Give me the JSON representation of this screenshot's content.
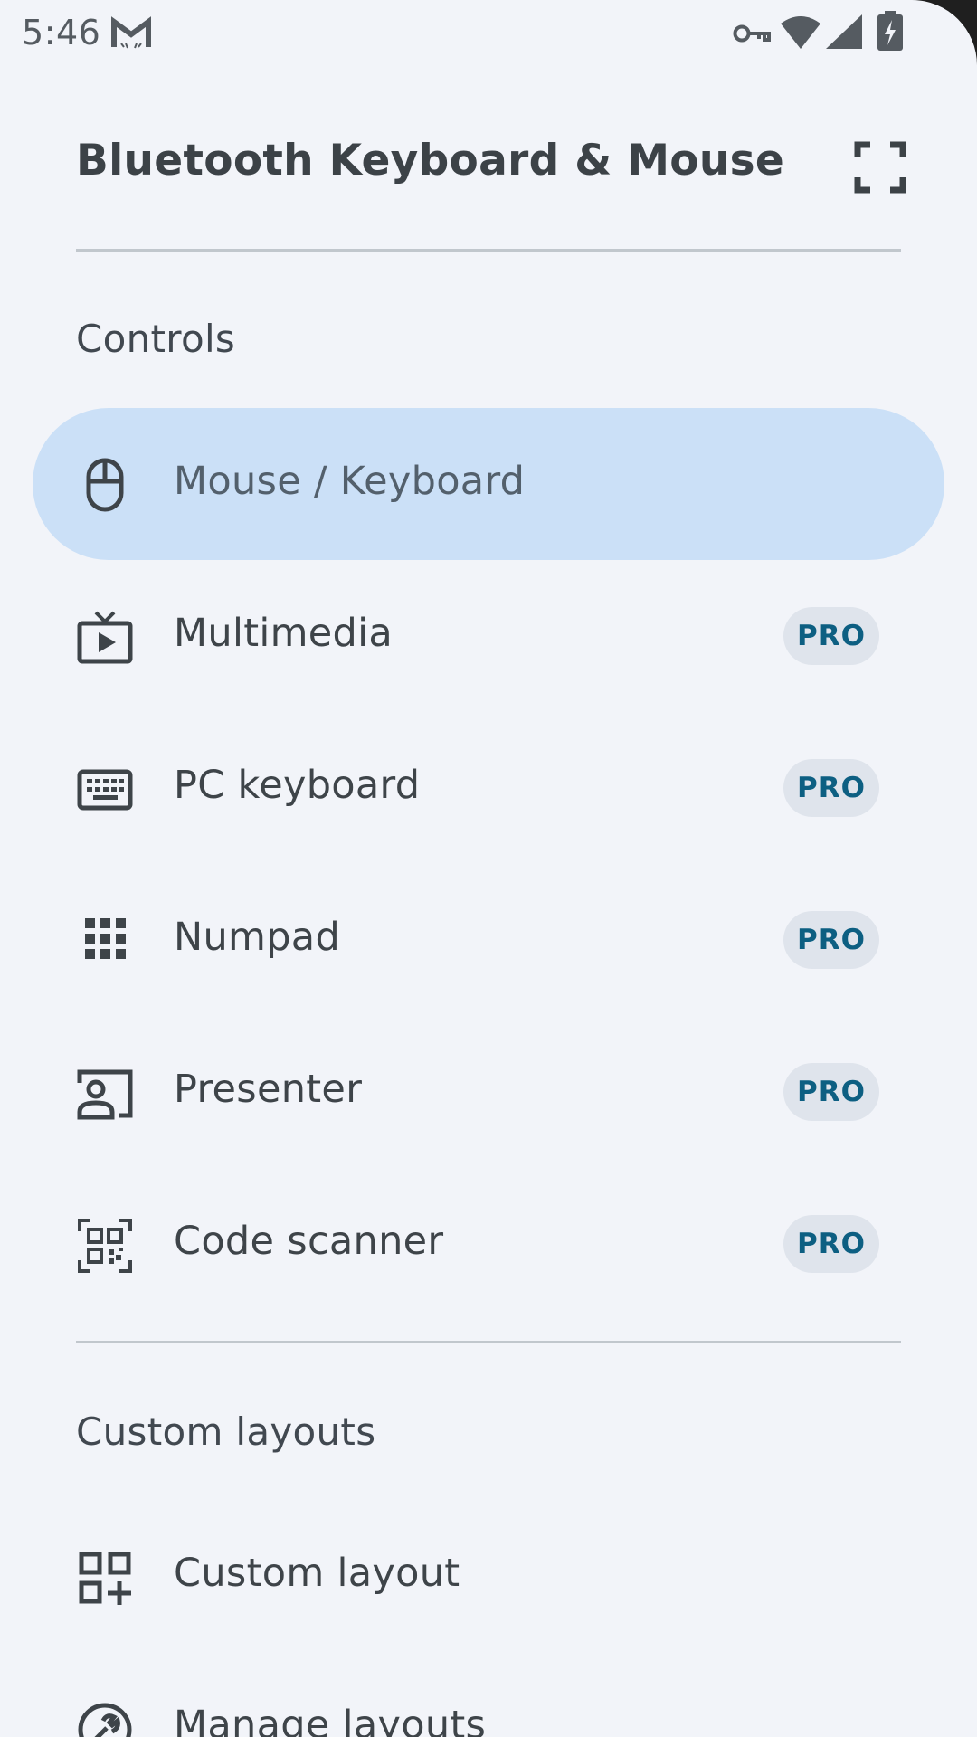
{
  "status_bar": {
    "time": "5:46",
    "icons": [
      "gmail-icon",
      "vpn-key-icon",
      "wifi-icon",
      "cell-signal-icon",
      "battery-charging-icon"
    ]
  },
  "drawer": {
    "title": "Bluetooth Keyboard & Mouse",
    "fullscreen_icon": "fullscreen-icon",
    "controls_section": {
      "header": "Controls",
      "items": [
        {
          "label": "Mouse / Keyboard",
          "icon": "mouse-icon",
          "active": true
        },
        {
          "label": "Multimedia",
          "icon": "tv-play-icon",
          "badge": "PRO"
        },
        {
          "label": "PC keyboard",
          "icon": "keyboard-icon",
          "badge": "PRO"
        },
        {
          "label": "Numpad",
          "icon": "dialpad-icon",
          "badge": "PRO"
        },
        {
          "label": "Presenter",
          "icon": "presenter-icon",
          "badge": "PRO"
        },
        {
          "label": "Code scanner",
          "icon": "qr-code-scanner-icon",
          "badge": "PRO"
        }
      ]
    },
    "custom_section": {
      "header": "Custom layouts",
      "items": [
        {
          "label": "Custom layout",
          "icon": "add-layout-icon"
        },
        {
          "label": "Manage layouts",
          "icon": "wrench-icon"
        }
      ]
    }
  },
  "colors": {
    "drawer_background": "#f2f4f9",
    "active_item_background": "#cbe0f7",
    "badge_background": "#dfe4ec",
    "badge_text": "#0d5f82",
    "text_primary": "#3e4449",
    "divider": "#c1c7cd"
  }
}
